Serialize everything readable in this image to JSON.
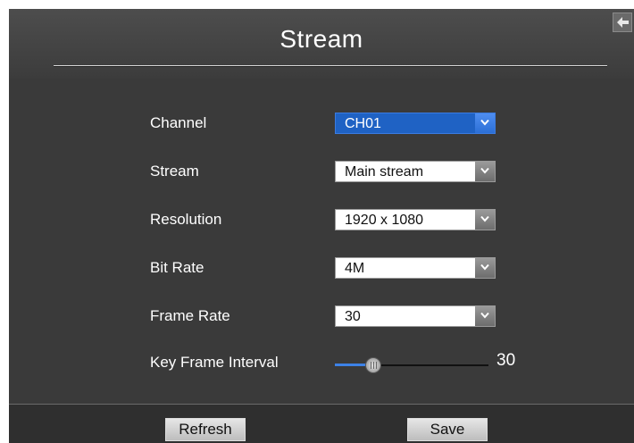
{
  "dialog": {
    "title": "Stream",
    "back_icon": "back-arrow-icon"
  },
  "fields": {
    "channel": {
      "label": "Channel",
      "value": "CH01"
    },
    "stream": {
      "label": "Stream",
      "value": "Main stream"
    },
    "resolution": {
      "label": "Resolution",
      "value": "1920 x 1080"
    },
    "bit_rate": {
      "label": "Bit Rate",
      "value": "4M"
    },
    "frame_rate": {
      "label": "Frame Rate",
      "value": "30"
    },
    "key_frame_interval": {
      "label": "Key Frame Interval",
      "value": "30",
      "level_fraction": 0.25
    }
  },
  "footer": {
    "refresh_label": "Refresh",
    "save_label": "Save"
  },
  "colors": {
    "background": "#3a3a3a",
    "accent": "#1f62c4",
    "footer": "#2f2f2f"
  }
}
